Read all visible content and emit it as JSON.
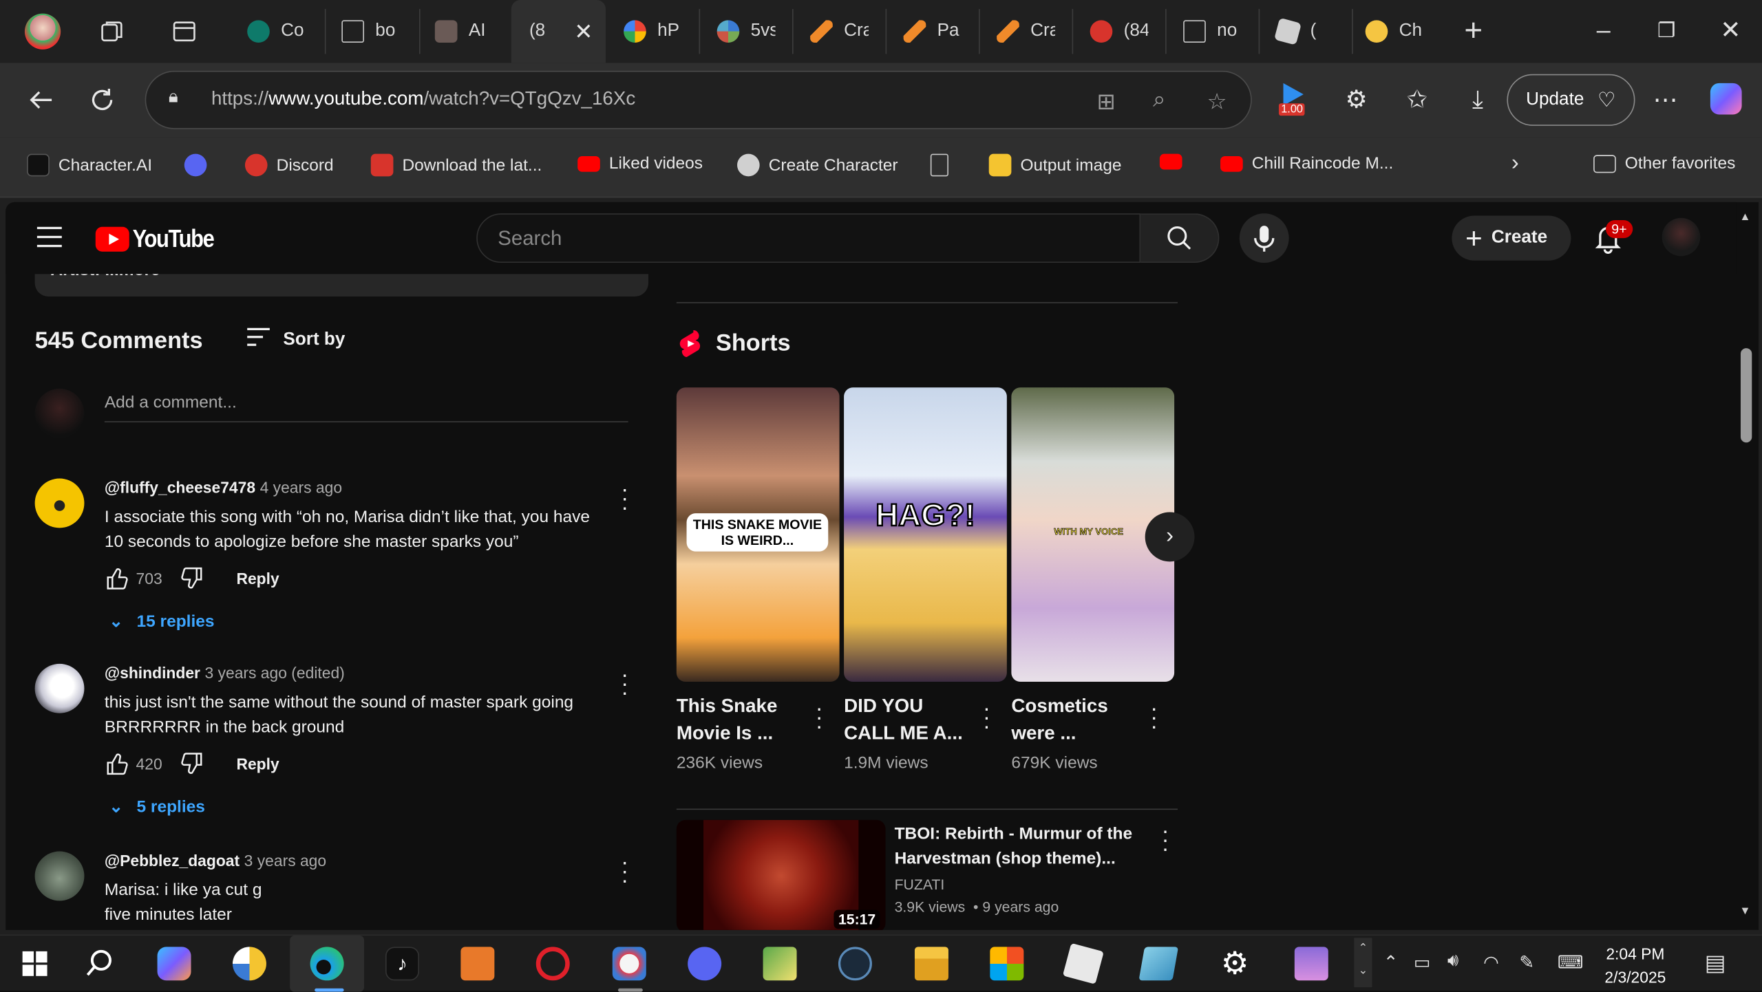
{
  "browser": {
    "tabs": [
      {
        "title": "Co",
        "color": "#0e7a6a"
      },
      {
        "title": "bo",
        "color": "#9e9e9e"
      },
      {
        "title": "AI",
        "color": "#6a5a56"
      },
      {
        "title": "(8",
        "color": "#2f2f2f",
        "active": true
      },
      {
        "title": "hP",
        "color": "#f4b400"
      },
      {
        "title": "5vs",
        "color": "#3a7bd5"
      },
      {
        "title": "Cra",
        "color": "#f08a2a"
      },
      {
        "title": "Pa",
        "color": "#f08a2a"
      },
      {
        "title": "Cra",
        "color": "#f08a2a"
      },
      {
        "title": "(84",
        "color": "#d8342c"
      },
      {
        "title": "no",
        "color": "#9e9e9e"
      },
      {
        "title": "(",
        "color": "#d0d0d0"
      },
      {
        "title": "Ch",
        "color": "#f5c542"
      }
    ],
    "url_prefix": "https://",
    "url_host": "www.youtube.com",
    "url_path": "/watch?v=QTgQzv_16Xc",
    "extension_badge": "1.00",
    "update_label": "Update",
    "favorites": [
      {
        "label": "Character.AI",
        "color": "#111111"
      },
      {
        "label": "",
        "color": "#5865f2"
      },
      {
        "label": "Discord",
        "color": "#d8342c"
      },
      {
        "label": "Download the lat...",
        "color": "#d8342c"
      },
      {
        "label": "Liked videos",
        "color": "#ff0000"
      },
      {
        "label": "Create Character",
        "color": "#d0d0d0"
      },
      {
        "label": "",
        "color": "#9e9e9e"
      },
      {
        "label": "Output image",
        "color": "#f4c430"
      },
      {
        "label": "",
        "color": "#ff0000"
      },
      {
        "label": "Chill Raincode M...",
        "color": "#ff0000"
      }
    ],
    "other_favorites": "Other favorites"
  },
  "youtube": {
    "logo_text": "YouTube",
    "search_placeholder": "Search",
    "create_label": "Create",
    "notifications_badge": "9+",
    "description_snippet": "Artist: ...more",
    "comments_count": "545 Comments",
    "sort_label": "Sort by",
    "add_comment_placeholder": "Add a comment...",
    "comments": [
      {
        "author": "@fluffy_cheese7478",
        "time": "4 years ago",
        "text": "I associate this song with “oh no, Marisa didn’t like that, you have 10 seconds to apologize before she master sparks you”",
        "likes": "703",
        "reply_label": "Reply",
        "replies": "15 replies",
        "avatar_color": "#f5c400"
      },
      {
        "author": "@shindinder",
        "time": "3 years ago (edited)",
        "text": "this just isn't the same without the sound of master spark going BRRRRRRR in the back ground",
        "likes": "420",
        "reply_label": "Reply",
        "replies": "5 replies",
        "avatar_color": "#e8e8f0"
      },
      {
        "author": "@Pebblez_dagoat",
        "time": "3 years ago",
        "text": "Marisa: i like ya cut g\nfive minutes later",
        "avatar_color": "#5a6a5a"
      }
    ],
    "shorts_title": "Shorts",
    "shorts": [
      {
        "title": "This Snake Movie Is ...",
        "views": "236K views",
        "overlay": "THIS SNAKE MOVIE IS WEIRD..."
      },
      {
        "title": "DID YOU CALL ME A...",
        "views": "1.9M views",
        "overlay": "HAG?!"
      },
      {
        "title": "Cosmetics were ...",
        "views": "679K views",
        "overlay": "WITH MY VOICE"
      }
    ],
    "video": {
      "title": "TBOI: Rebirth - Murmur of the Harvestman (shop theme)...",
      "channel": "FUZATI",
      "views": "3.9K views",
      "age": "9 years ago",
      "duration": "15:17"
    }
  },
  "taskbar": {
    "time": "2:04 PM",
    "date": "2/3/2025"
  }
}
